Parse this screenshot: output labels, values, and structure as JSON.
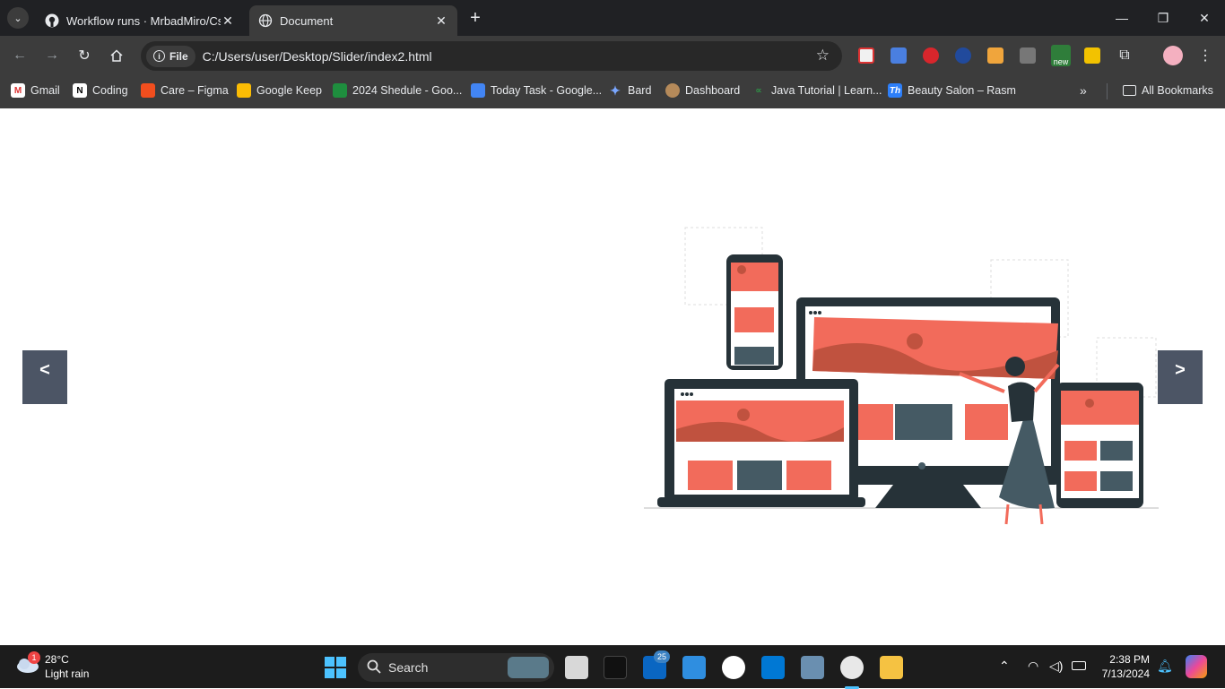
{
  "browser": {
    "tabs": [
      {
        "title": "Workflow runs · MrbadMiro/Css",
        "active": false
      },
      {
        "title": "Document",
        "active": true
      }
    ],
    "new_tab": "+",
    "address": {
      "scheme_chip": "File",
      "url": "C:/Users/user/Desktop/Slider/index2.html"
    },
    "extensions": {
      "new_badge": "new"
    },
    "bookmarks": [
      {
        "label": "Gmail",
        "icon": "gmail-icon"
      },
      {
        "label": "Coding",
        "icon": "notion-icon"
      },
      {
        "label": "Care – Figma",
        "icon": "figma-icon"
      },
      {
        "label": "Google Keep",
        "icon": "keep-icon"
      },
      {
        "label": "2024 Shedule - Goo...",
        "icon": "sheets-icon"
      },
      {
        "label": "Today Task - Google...",
        "icon": "docs-icon"
      },
      {
        "label": "Bard",
        "icon": "bard-icon"
      },
      {
        "label": "Dashboard",
        "icon": "dashboard-icon"
      },
      {
        "label": "Java Tutorial | Learn...",
        "icon": "gfg-icon"
      },
      {
        "label": "Beauty Salon – Rasm",
        "icon": "th-icon"
      }
    ],
    "all_bookmarks": "All Bookmarks"
  },
  "page": {
    "prev_label": "<",
    "next_label": ">",
    "illustration": "responsive-devices-illustration"
  },
  "taskbar": {
    "weather": {
      "temp": "28°C",
      "condition": "Light rain",
      "badge": "1"
    },
    "search_placeholder": "Search",
    "linkedin_badge": "25",
    "time": "2:38 PM",
    "date": "7/13/2024"
  },
  "colors": {
    "accent": "#f26b5b",
    "slate": "#465560",
    "button": "#4c5565"
  }
}
